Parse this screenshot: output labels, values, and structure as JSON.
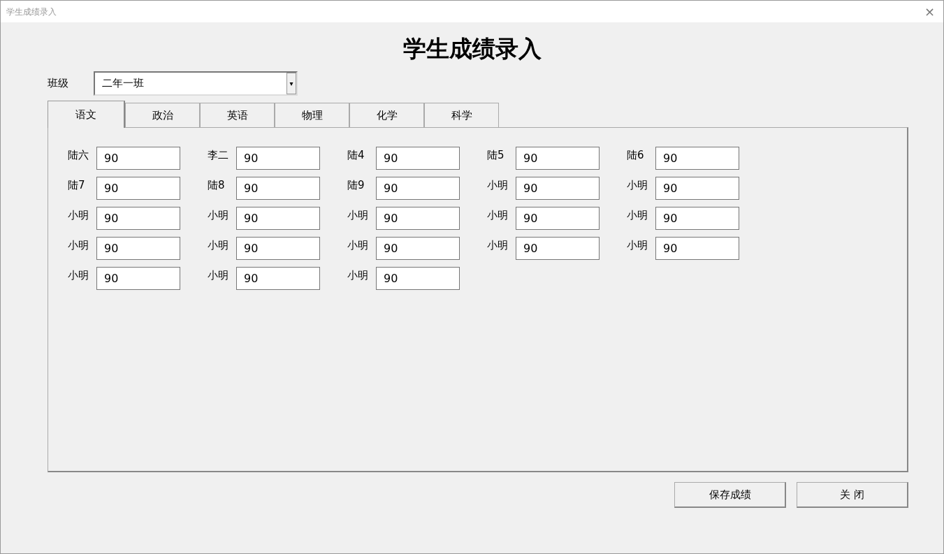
{
  "window": {
    "title": "学生成绩录入",
    "close": "×"
  },
  "heading": "学生成绩录入",
  "class_field": {
    "label": "班级",
    "value": "二年一班",
    "arrow": "▾"
  },
  "tabs": [
    {
      "label": "语文",
      "selected": true
    },
    {
      "label": "政治",
      "selected": false
    },
    {
      "label": "英语",
      "selected": false
    },
    {
      "label": "物理",
      "selected": false
    },
    {
      "label": "化学",
      "selected": false
    },
    {
      "label": "科学",
      "selected": false
    }
  ],
  "students": [
    {
      "name": "陆六",
      "score": "90"
    },
    {
      "name": "李二",
      "score": "90"
    },
    {
      "name": "陆4",
      "score": "90"
    },
    {
      "name": "陆5",
      "score": "90"
    },
    {
      "name": "陆6",
      "score": "90"
    },
    {
      "name": "陆7",
      "score": "90"
    },
    {
      "name": "陆8",
      "score": "90"
    },
    {
      "name": "陆9",
      "score": "90"
    },
    {
      "name": "小明",
      "score": "90"
    },
    {
      "name": "小明",
      "score": "90"
    },
    {
      "name": "小明",
      "score": "90"
    },
    {
      "name": "小明",
      "score": "90"
    },
    {
      "name": "小明",
      "score": "90"
    },
    {
      "name": "小明",
      "score": "90"
    },
    {
      "name": "小明",
      "score": "90"
    },
    {
      "name": "小明",
      "score": "90"
    },
    {
      "name": "小明",
      "score": "90"
    },
    {
      "name": "小明",
      "score": "90"
    },
    {
      "name": "小明",
      "score": "90"
    },
    {
      "name": "小明",
      "score": "90"
    },
    {
      "name": "小明",
      "score": "90"
    },
    {
      "name": "小明",
      "score": "90"
    },
    {
      "name": "小明",
      "score": "90"
    }
  ],
  "buttons": [
    "保存成绩",
    "关 闭"
  ]
}
